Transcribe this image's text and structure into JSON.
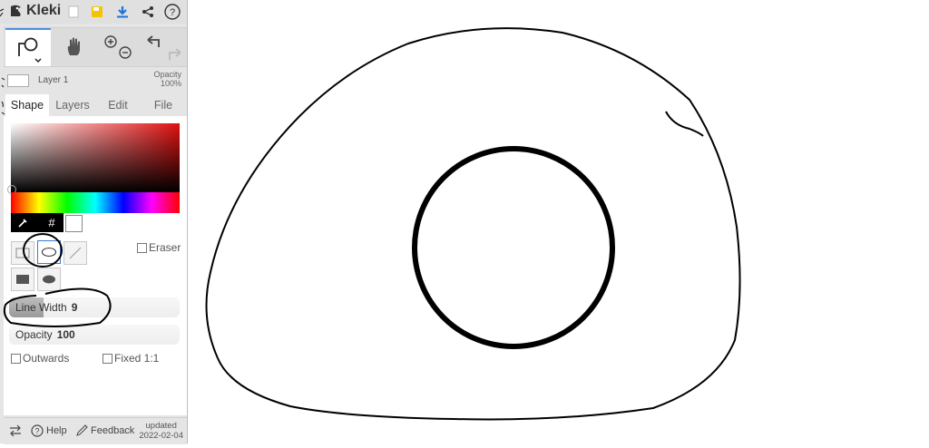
{
  "app": {
    "title": "Kleki"
  },
  "topbar": {
    "icons": [
      "new-file-icon",
      "save-icon",
      "download-icon",
      "share-icon",
      "help-icon"
    ]
  },
  "tools": [
    "shape-tool-icon",
    "hand-tool-icon",
    "zoom-icon",
    "undo-icon",
    "redo-icon"
  ],
  "layer": {
    "name": "Layer 1",
    "opacity_label": "Opacity",
    "opacity_value": "100%"
  },
  "tabs": [
    {
      "label": "Shape"
    },
    {
      "label": "Layers"
    },
    {
      "label": "Edit"
    },
    {
      "label": "File"
    }
  ],
  "color": {
    "hex_label": "#",
    "primary": "#ffffff",
    "accent": "#3a7bd5"
  },
  "shape_panel": {
    "eraser_label": "Eraser",
    "line_width_label": "Line Width",
    "line_width_value": "9",
    "line_width_fraction": 0.2,
    "opacity_label": "Opacity",
    "opacity_value": "100",
    "outwards_label": "Outwards",
    "fixed_label": "Fixed 1:1"
  },
  "bottom": {
    "help_label": "Help",
    "feedback_label": "Feedback",
    "updated_label": "updated",
    "updated_date": "2022-02-04"
  }
}
